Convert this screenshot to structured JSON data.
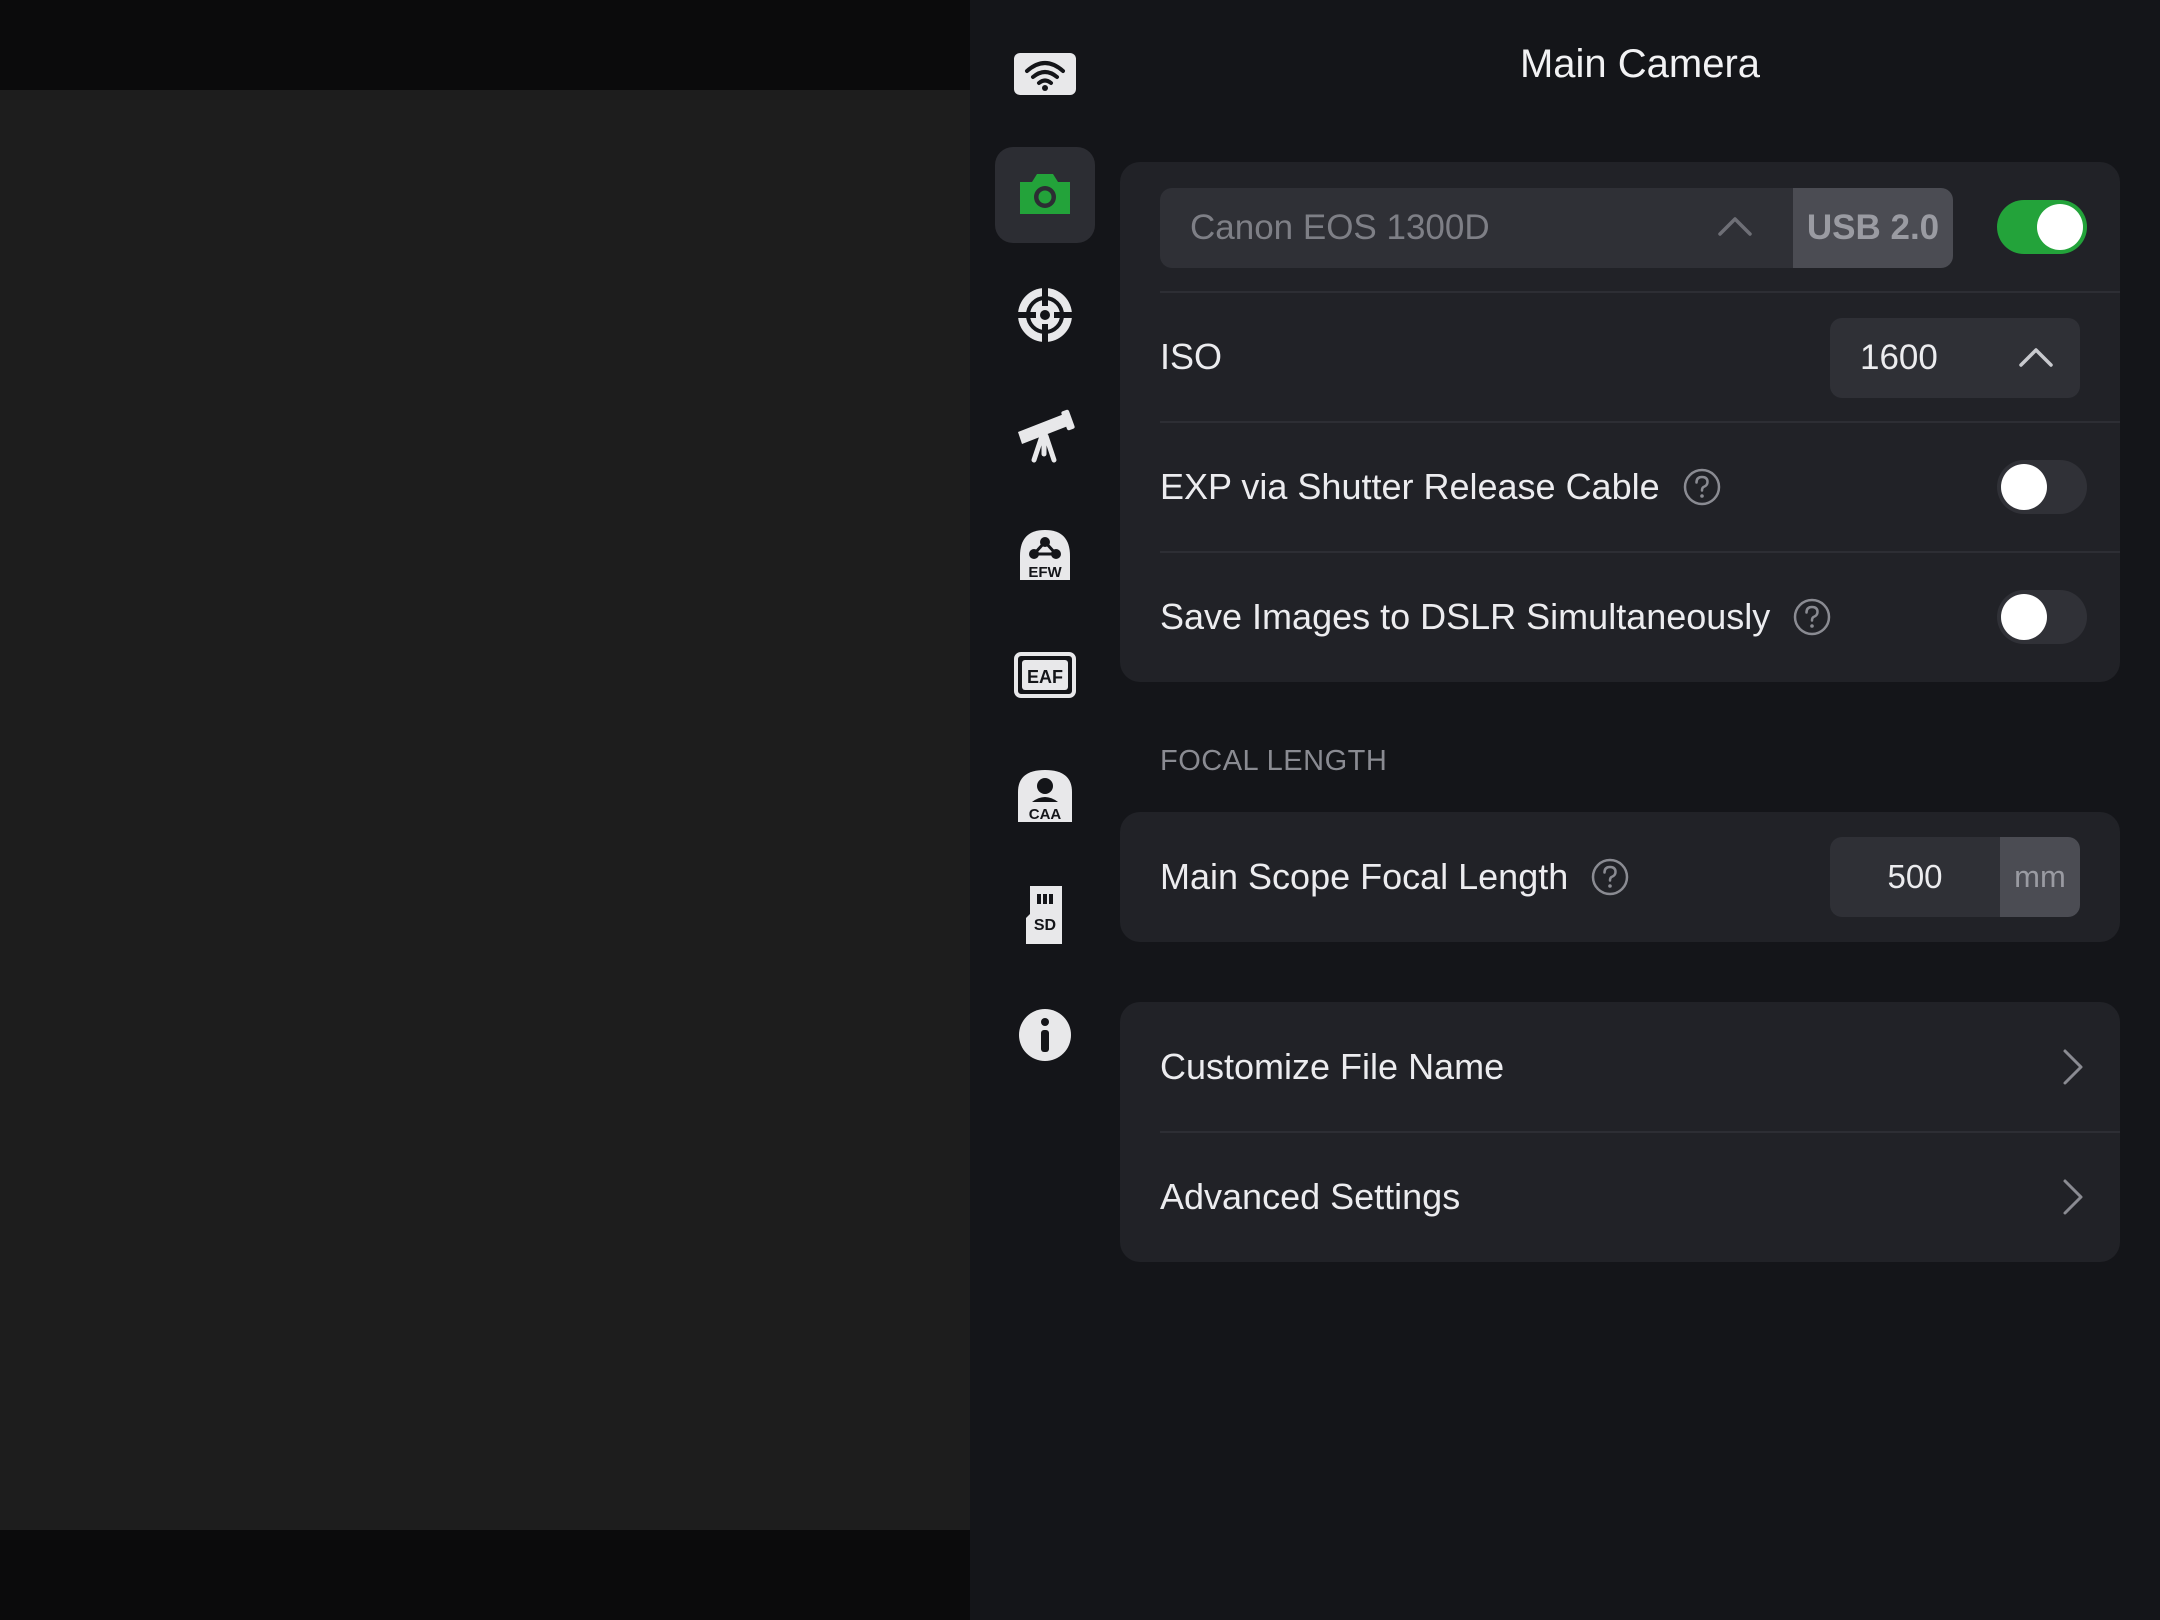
{
  "title": "Main Camera",
  "rail": {
    "items": [
      {
        "icon": "wifi-icon"
      },
      {
        "icon": "camera-icon",
        "active": true,
        "color": "#23a33a"
      },
      {
        "icon": "guide-target-icon"
      },
      {
        "icon": "telescope-icon"
      },
      {
        "icon": "filter-wheel-icon",
        "text": "EFW"
      },
      {
        "icon": "focuser-icon",
        "text": "EAF"
      },
      {
        "icon": "rotator-icon",
        "text": "CAA"
      },
      {
        "icon": "sd-card-icon",
        "text": "SD"
      },
      {
        "icon": "info-icon"
      }
    ]
  },
  "camera": {
    "selected": "Canon EOS 1300D",
    "connection": "USB 2.0",
    "enabled": true
  },
  "iso": {
    "label": "ISO",
    "value": "1600"
  },
  "exp_shutter": {
    "label": "EXP via Shutter Release Cable",
    "enabled": false
  },
  "save_dslr": {
    "label": "Save Images to DSLR Simultaneously",
    "enabled": false
  },
  "focal_section": {
    "label": "FOCAL LENGTH",
    "row_label": "Main Scope Focal Length",
    "value": "500",
    "unit": "mm"
  },
  "nav": {
    "customize_file_name": "Customize File Name",
    "advanced_settings": "Advanced Settings"
  },
  "colors": {
    "accent_green": "#23a33a",
    "panel_bg": "#141519",
    "card_bg": "#212227"
  }
}
